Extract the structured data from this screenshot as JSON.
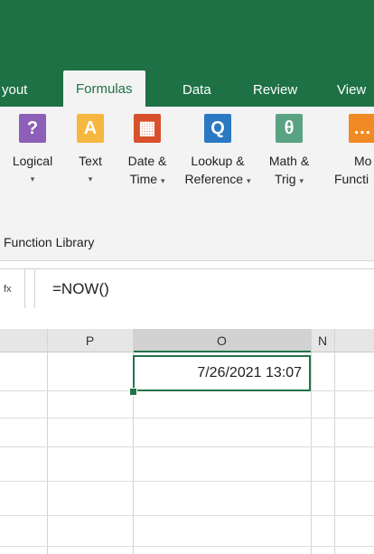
{
  "tabs": [
    "yout",
    "Formulas",
    "Data",
    "Review",
    "View"
  ],
  "ribbon": {
    "buttons": [
      {
        "name": "logical",
        "line1": "Logical",
        "line2": "",
        "icon": "?",
        "color": "#8e5fb8"
      },
      {
        "name": "text",
        "line1": "Text",
        "line2": "",
        "icon": "A",
        "color": "#f6b740"
      },
      {
        "name": "date-time",
        "line1": "Date &",
        "line2": "Time",
        "icon": "▦",
        "color": "#d9512c"
      },
      {
        "name": "lookup-reference",
        "line1": "Lookup &",
        "line2": "Reference",
        "icon": "Q",
        "color": "#2b79c2"
      },
      {
        "name": "math-trig",
        "line1": "Math &",
        "line2": "Trig",
        "icon": "θ",
        "color": "#5aa382"
      },
      {
        "name": "more-functions",
        "line1": "Mo",
        "line2": "Functi",
        "icon": "…",
        "color": "#f08a24"
      }
    ],
    "group_label": "Function Library"
  },
  "formula_bar": {
    "name_box": "fx",
    "formula": "=NOW()"
  },
  "columns": [
    "P",
    "O",
    "N"
  ],
  "active_cell": {
    "value": "7/26/2021 13:07"
  }
}
